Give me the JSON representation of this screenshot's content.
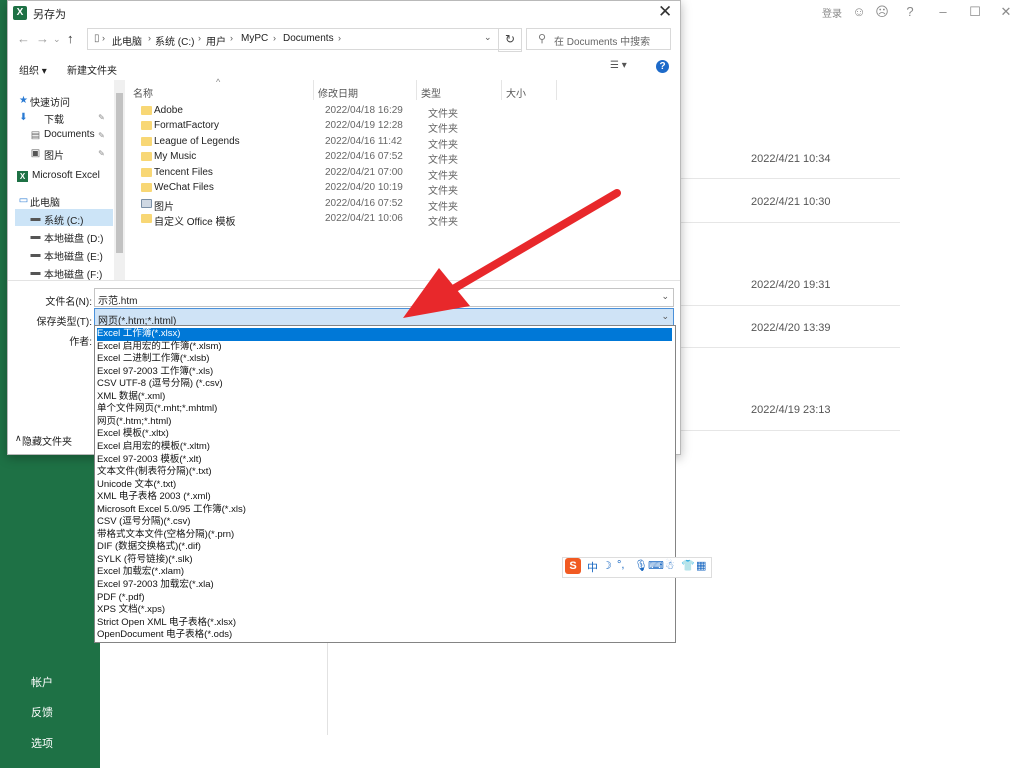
{
  "window": {
    "login": "登录",
    "min_icon": "minimize-icon",
    "max_icon": "maximize-icon",
    "close_icon": "close-icon"
  },
  "backstage": {
    "nav": [
      "帐户",
      "反馈",
      "选项"
    ],
    "dates": [
      "2022/4/21 10:34",
      "2022/4/21 10:30",
      "2022/4/20 19:31",
      "2022/4/20 13:39",
      "2022/4/19 23:13"
    ],
    "accent": "#1e7145"
  },
  "dialog": {
    "title": "另存为",
    "address": {
      "crumbs": [
        "此电脑",
        "系统 (C:)",
        "用户",
        "MyPC",
        "Documents"
      ]
    },
    "search_placeholder": "在 Documents 中搜索",
    "toolbar": {
      "organize": "组织 ▾",
      "new_folder": "新建文件夹"
    },
    "nav_pane": [
      {
        "label": "快速访问",
        "icon": "star-icon"
      },
      {
        "label": "下载",
        "icon": "download-icon"
      },
      {
        "label": "Documents",
        "icon": "document-icon"
      },
      {
        "label": "图片",
        "icon": "picture-icon"
      },
      {
        "label": "Microsoft Excel",
        "icon": "excel-icon"
      },
      {
        "label": "此电脑",
        "icon": "computer-icon"
      },
      {
        "label": "系统 (C:)",
        "icon": "drive-icon"
      },
      {
        "label": "本地磁盘 (D:)",
        "icon": "drive-icon"
      },
      {
        "label": "本地磁盘 (E:)",
        "icon": "drive-icon"
      },
      {
        "label": "本地磁盘 (F:)",
        "icon": "drive-icon"
      }
    ],
    "columns": [
      "名称",
      "修改日期",
      "类型",
      "大小"
    ],
    "files": [
      {
        "name": "Adobe",
        "date": "2022/04/18 16:29",
        "type": "文件夹"
      },
      {
        "name": "FormatFactory",
        "date": "2022/04/19 12:28",
        "type": "文件夹"
      },
      {
        "name": "League of Legends",
        "date": "2022/04/16 11:42",
        "type": "文件夹"
      },
      {
        "name": "My Music",
        "date": "2022/04/16 07:52",
        "type": "文件夹"
      },
      {
        "name": "Tencent Files",
        "date": "2022/04/21 07:00",
        "type": "文件夹"
      },
      {
        "name": "WeChat Files",
        "date": "2022/04/20 10:19",
        "type": "文件夹"
      },
      {
        "name": "图片",
        "date": "2022/04/16 07:52",
        "type": "文件夹"
      },
      {
        "name": "自定义 Office 模板",
        "date": "2022/04/21 10:06",
        "type": "文件夹"
      }
    ],
    "filename_label": "文件名(N):",
    "filename_value": "示范.htm",
    "filetype_label": "保存类型(T):",
    "filetype_value": "网页(*.htm;*.html)",
    "author_label": "作者:",
    "hide_folders": "隐藏文件夹",
    "filetype_options": [
      "Excel 工作簿(*.xlsx)",
      "Excel 启用宏的工作簿(*.xlsm)",
      "Excel 二进制工作簿(*.xlsb)",
      "Excel 97-2003 工作簿(*.xls)",
      "CSV UTF-8 (逗号分隔) (*.csv)",
      "XML 数据(*.xml)",
      "单个文件网页(*.mht;*.mhtml)",
      "网页(*.htm;*.html)",
      "Excel 模板(*.xltx)",
      "Excel 启用宏的模板(*.xltm)",
      "Excel 97-2003 模板(*.xlt)",
      "文本文件(制表符分隔)(*.txt)",
      "Unicode 文本(*.txt)",
      "XML 电子表格 2003 (*.xml)",
      "Microsoft Excel 5.0/95 工作簿(*.xls)",
      "CSV (逗号分隔)(*.csv)",
      "带格式文本文件(空格分隔)(*.prn)",
      "DIF (数据交换格式)(*.dif)",
      "SYLK (符号链接)(*.slk)",
      "Excel 加载宏(*.xlam)",
      "Excel 97-2003 加载宏(*.xla)",
      "PDF (*.pdf)",
      "XPS 文档(*.xps)",
      "Strict Open XML 电子表格(*.xlsx)",
      "OpenDocument 电子表格(*.ods)"
    ],
    "selected_option_index": 0
  },
  "ime": {
    "logo": "S",
    "mode": "中"
  },
  "annotation": {
    "arrow_color": "#e8282b"
  }
}
